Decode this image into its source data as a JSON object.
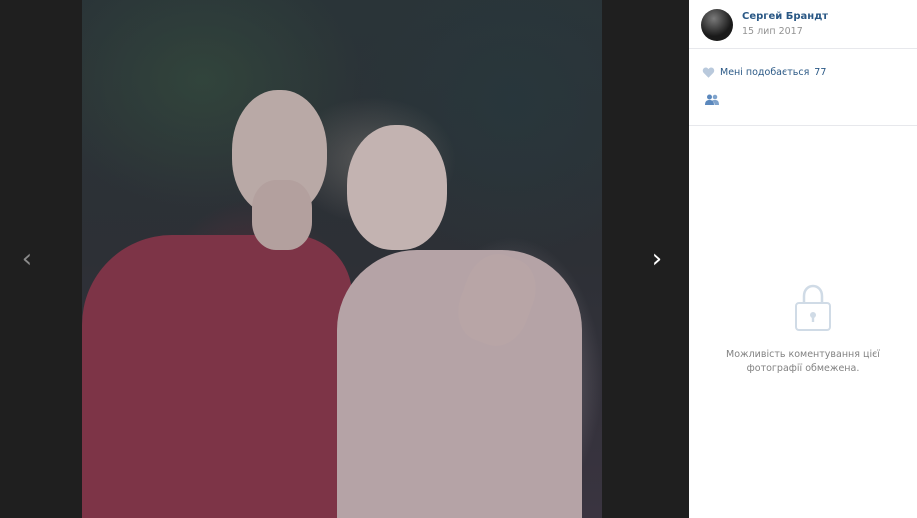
{
  "viewer": {
    "prev_arrow": "‹",
    "next_arrow": "›",
    "photo_name": "photo"
  },
  "author": {
    "name": "Сергей Брандт",
    "date": "15 лип 2017"
  },
  "actions": {
    "like_label": "Мені подобається",
    "like_count": "77",
    "heart_icon": "heart-icon",
    "share_icon": "share-icon"
  },
  "comments": {
    "closed_message": "Можливість коментування цієї фотографії обмежена.",
    "lock_icon": "lock-icon"
  },
  "colors": {
    "link": "#2a5885",
    "muted": "#939393",
    "viewer_bg": "#1f1f1f"
  }
}
